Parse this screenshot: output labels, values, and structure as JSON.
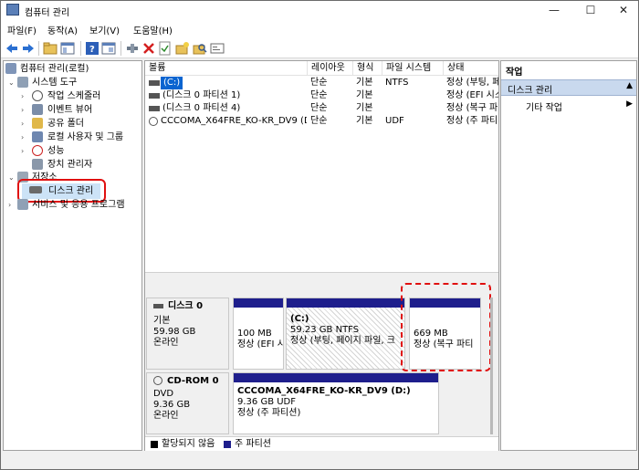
{
  "window": {
    "title": "컴퓨터 관리",
    "controls": {
      "minimize": "—",
      "maximize": "☐",
      "close": "✕"
    }
  },
  "menu": [
    "파일(F)",
    "동작(A)",
    "보기(V)",
    "도움말(H)"
  ],
  "toolbar": {
    "buttons": [
      "back-arrow-icon",
      "forward-arrow-icon",
      "folder-up-icon",
      "console-tree-icon",
      "help-icon",
      "properties-icon",
      "connect-icon",
      "delete-icon",
      "check-icon",
      "new-folder-icon",
      "search-icon",
      "export-icon"
    ]
  },
  "tree": {
    "root": "컴퓨터 관리(로컬)",
    "system_tools": "시스템 도구",
    "system_children": [
      "작업 스케줄러",
      "이벤트 뷰어",
      "공유 폴더",
      "로컬 사용자 및 그룹",
      "성능",
      "장치 관리자"
    ],
    "storage": "저장소",
    "disk_management": "디스크 관리",
    "services": "서비스 및 응용 프로그램"
  },
  "volume_list": {
    "columns": [
      "볼륨",
      "레이아웃",
      "형식",
      "파일 시스템",
      "상태"
    ],
    "rows": [
      {
        "volume": "(C:)",
        "layout": "단순",
        "type": "기본",
        "fs": "NTFS",
        "status": "정상 (부팅, 페"
      },
      {
        "volume": "(디스크 0 파티션 1)",
        "layout": "단순",
        "type": "기본",
        "fs": "",
        "status": "정상 (EFI 시스"
      },
      {
        "volume": "(디스크 0 파티션 4)",
        "layout": "단순",
        "type": "기본",
        "fs": "",
        "status": "정상 (복구 파"
      },
      {
        "volume": "CCCOMA_X64FRE_KO-KR_DV9 (D:)",
        "layout": "단순",
        "type": "기본",
        "fs": "UDF",
        "status": "정상 (주 파티"
      }
    ]
  },
  "disks": [
    {
      "name": "디스크 0",
      "kind": "기본",
      "size": "59.98 GB",
      "state": "온라인",
      "partitions": [
        {
          "title": "",
          "line1": "100 MB",
          "line2": "정상 (EFI 시"
        },
        {
          "title": "(C:)",
          "line1": "59.23 GB NTFS",
          "line2": "정상 (부팅, 페이지 파일, 크"
        },
        {
          "title": "",
          "line1": "669 MB",
          "line2": "정상 (복구 파티"
        }
      ]
    },
    {
      "name": "CD-ROM 0",
      "kind": "DVD",
      "size": "9.36 GB",
      "state": "온라인",
      "partitions": [
        {
          "title": "CCCOMA_X64FRE_KO-KR_DV9  (D:)",
          "line1": "9.36 GB UDF",
          "line2": "정상 (주 파티션)"
        }
      ]
    }
  ],
  "legend": {
    "unallocated": "할당되지 않음",
    "primary": "주 파티션"
  },
  "actions": {
    "header": "작업",
    "section": "디스크 관리",
    "more": "기타 작업"
  },
  "colors": {
    "partition_bar": "#1e1e8c",
    "highlight_red": "#e01010",
    "section_bg": "#c9d9ee"
  }
}
